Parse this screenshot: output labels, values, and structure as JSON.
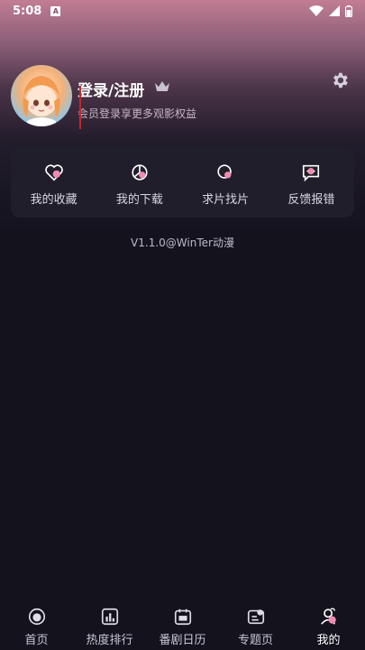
{
  "status": {
    "time": "5:08",
    "badge": "A"
  },
  "profile": {
    "title": "登录/注册",
    "subtitle": "会员登录享更多观影权益"
  },
  "menu": {
    "items": [
      {
        "label": "我的收藏",
        "icon": "heart-icon"
      },
      {
        "label": "我的下载",
        "icon": "download-icon"
      },
      {
        "label": "求片找片",
        "icon": "search-film-icon"
      },
      {
        "label": "反馈报错",
        "icon": "feedback-icon"
      }
    ]
  },
  "version": "V1.1.0@WinTer动漫",
  "nav": {
    "items": [
      {
        "label": "首页",
        "icon": "home-icon"
      },
      {
        "label": "热度排行",
        "icon": "ranking-icon"
      },
      {
        "label": "番剧日历",
        "icon": "calendar-icon"
      },
      {
        "label": "专题页",
        "icon": "topic-icon"
      },
      {
        "label": "我的",
        "icon": "profile-icon"
      }
    ],
    "active_index": 4
  },
  "colors": {
    "accent": "#f08bb0",
    "background": "#13121d",
    "card": "#1f1e2a"
  }
}
